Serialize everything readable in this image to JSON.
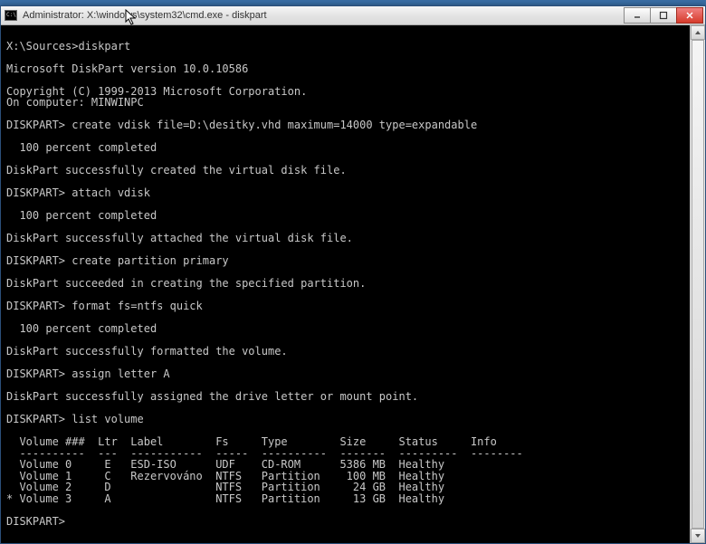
{
  "window": {
    "title": "Administrator: X:\\windows\\system32\\cmd.exe - diskpart",
    "icon_glyph": "C:\\"
  },
  "console": {
    "lines": [
      "",
      "X:\\Sources>diskpart",
      "",
      "Microsoft DiskPart version 10.0.10586",
      "",
      "Copyright (C) 1999-2013 Microsoft Corporation.",
      "On computer: MINWINPC",
      "",
      "DISKPART> create vdisk file=D:\\desitky.vhd maximum=14000 type=expandable",
      "",
      "  100 percent completed",
      "",
      "DiskPart successfully created the virtual disk file.",
      "",
      "DISKPART> attach vdisk",
      "",
      "  100 percent completed",
      "",
      "DiskPart successfully attached the virtual disk file.",
      "",
      "DISKPART> create partition primary",
      "",
      "DiskPart succeeded in creating the specified partition.",
      "",
      "DISKPART> format fs=ntfs quick",
      "",
      "  100 percent completed",
      "",
      "DiskPart successfully formatted the volume.",
      "",
      "DISKPART> assign letter A",
      "",
      "DiskPart successfully assigned the drive letter or mount point.",
      "",
      "DISKPART> list volume",
      ""
    ],
    "table_header": "  Volume ###  Ltr  Label        Fs     Type        Size     Status     Info",
    "table_divider": "  ----------  ---  -----------  -----  ----------  -------  ---------  --------",
    "volumes": [
      {
        "marker": " ",
        "num": "Volume 0",
        "ltr": "E",
        "label": "ESD-ISO",
        "fs": "UDF",
        "type": "CD-ROM",
        "size": "5386 MB",
        "status": "Healthy",
        "info": ""
      },
      {
        "marker": " ",
        "num": "Volume 1",
        "ltr": "C",
        "label": "Rezervováno",
        "fs": "NTFS",
        "type": "Partition",
        "size": "100 MB",
        "status": "Healthy",
        "info": ""
      },
      {
        "marker": " ",
        "num": "Volume 2",
        "ltr": "D",
        "label": "",
        "fs": "NTFS",
        "type": "Partition",
        "size": "24 GB",
        "status": "Healthy",
        "info": ""
      },
      {
        "marker": "*",
        "num": "Volume 3",
        "ltr": "A",
        "label": "",
        "fs": "NTFS",
        "type": "Partition",
        "size": "13 GB",
        "status": "Healthy",
        "info": ""
      }
    ],
    "prompt_last": "DISKPART>"
  }
}
